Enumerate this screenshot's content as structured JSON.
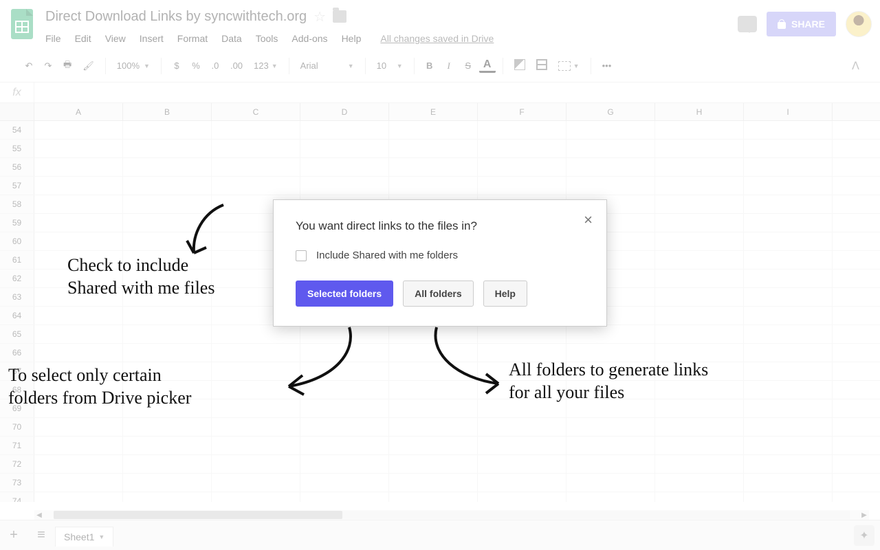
{
  "doc_title": "Direct Download Links by syncwithtech.org",
  "menus": [
    "File",
    "Edit",
    "View",
    "Insert",
    "Format",
    "Data",
    "Tools",
    "Add-ons",
    "Help"
  ],
  "save_status": "All changes saved in Drive",
  "share_label": "SHARE",
  "zoom_pct": "100%",
  "number_format": "123",
  "font_name": "Arial",
  "font_size": "10",
  "columns": [
    "A",
    "B",
    "C",
    "D",
    "E",
    "F",
    "G",
    "H",
    "I"
  ],
  "row_start": 54,
  "row_count": 21,
  "sheet_tab": "Sheet1",
  "dialog": {
    "question": "You want direct links to the files in?",
    "checkbox_label": "Include Shared with me folders",
    "btn_selected": "Selected folders",
    "btn_all": "All folders",
    "btn_help": "Help"
  },
  "annotations": {
    "a1": "Check to include\nShared with me files",
    "a2": "To select only certain\nfolders from Drive picker",
    "a3": "All folders to generate links\nfor all your files"
  }
}
